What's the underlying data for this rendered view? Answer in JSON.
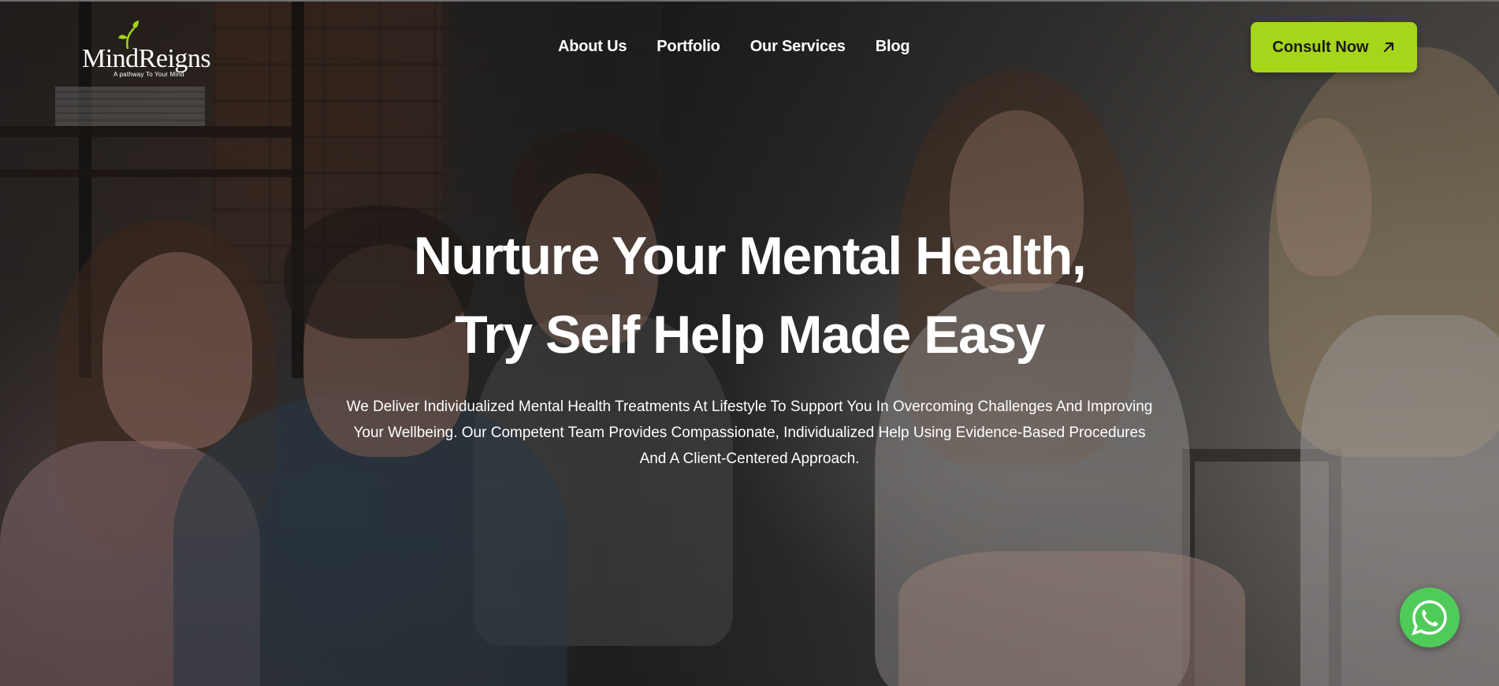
{
  "header": {
    "logo": {
      "name": "MindReigns",
      "tagline": "A pathway To Your Mind",
      "icon": "leaf-sprout-icon"
    },
    "nav": [
      {
        "label": "About Us"
      },
      {
        "label": "Portfolio"
      },
      {
        "label": "Our Services"
      },
      {
        "label": "Blog"
      }
    ],
    "cta": {
      "label": "Consult Now",
      "icon": "arrow-up-right-icon",
      "color": "#a5d61a"
    }
  },
  "hero": {
    "headline_line1": "Nurture Your Mental Health,",
    "headline_line2": "Try Self Help Made Easy",
    "subtext": "We Deliver Individualized Mental Health Treatments At Lifestyle To Support You In Overcoming Challenges And Improving Your Wellbeing. Our Competent Team Provides Compassionate, Individualized Help Using Evidence-Based Procedures And A Client-Centered Approach.",
    "background_image": "family-therapy-session-photo"
  },
  "floating": {
    "whatsapp": {
      "icon": "whatsapp-icon",
      "color": "#4fcb5a"
    }
  }
}
